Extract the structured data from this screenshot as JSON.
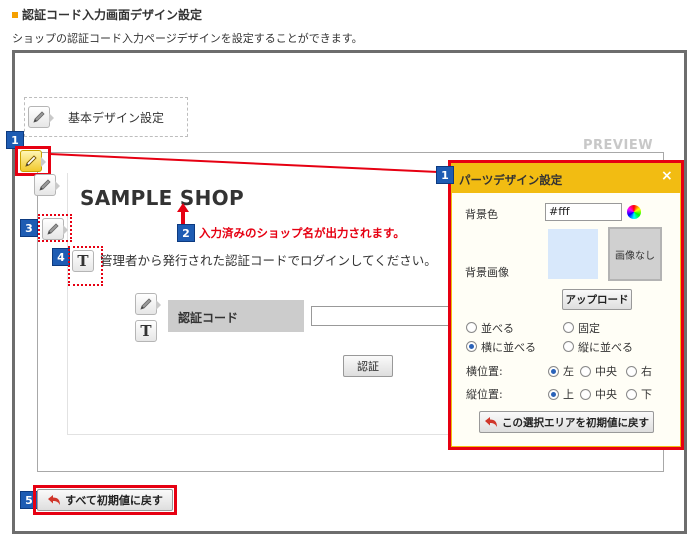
{
  "header": {
    "title": "認証コード入力画面デザイン設定",
    "description": "ショップの認証コード入力ページデザインを設定することができます。"
  },
  "base_design": {
    "label": "基本デザイン設定"
  },
  "preview": {
    "label": "PREVIEW",
    "shop_name": "SAMPLE SHOP",
    "message": "管理者から発行された認証コードでログインしてください。",
    "code_label": "認証コード",
    "code_value": "",
    "auth_button": "認証"
  },
  "annotations": {
    "badge_1": "1",
    "badge_1b": "1",
    "badge_2": "2",
    "badge_3": "3",
    "badge_4": "4",
    "badge_5": "5",
    "note_2": "入力済みのショップ名が出力されます。",
    "color": "#e60012"
  },
  "parts_panel": {
    "title": "パーツデザイン設定",
    "close": "×",
    "bg_color_label": "背景色",
    "bg_color_value": "#fff",
    "bg_image_label": "背景画像",
    "no_image": "画像なし",
    "upload": "アップロード",
    "repeat": "並べる",
    "fixed": "固定",
    "repeat_x": "横に並べる",
    "repeat_y": "縦に並べる",
    "h_pos_label": "横位置:",
    "v_pos_label": "縦位置:",
    "h_left": "左",
    "h_center": "中央",
    "h_right": "右",
    "v_top": "上",
    "v_center": "中央",
    "v_bottom": "下",
    "reset_area": "この選択エリアを初期値に戻す",
    "header_color": "#f2bc12"
  },
  "footer": {
    "reset_all": "すべて初期値に戻す"
  },
  "icons": {
    "pencil": "pencil-icon",
    "text": "text-icon",
    "undo": "undo-icon",
    "color_wheel": "color-picker-icon"
  }
}
